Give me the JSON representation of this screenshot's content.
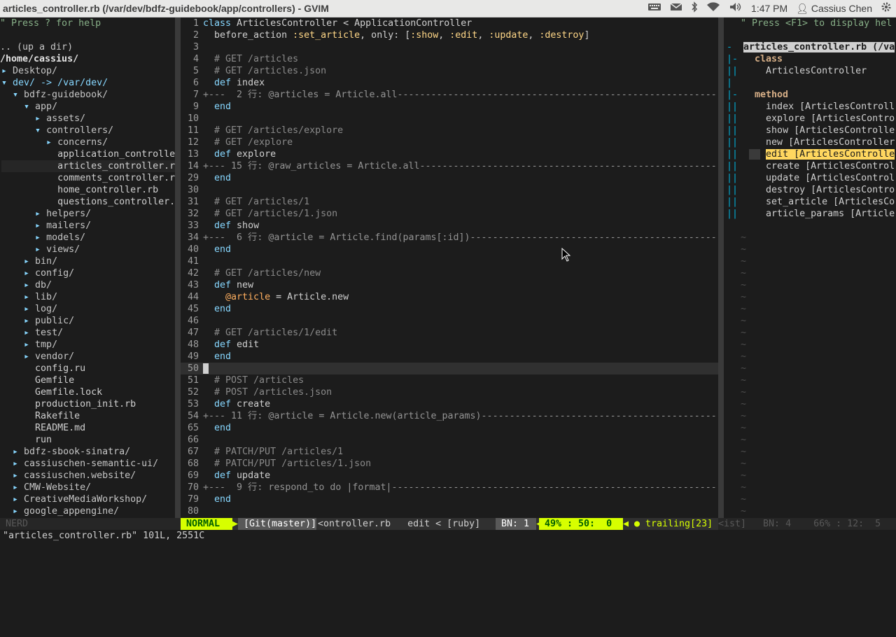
{
  "window": {
    "title": "articles_controller.rb (/var/dev/bdfz-guidebook/app/controllers) - GVIM"
  },
  "system_tray": {
    "time": "1:47 PM",
    "user": "Cassius Chen"
  },
  "nerdtree": {
    "help": "\" Press ? for help",
    "up_dir": ".. (up a dir)",
    "root": "/home/cassius/",
    "entries": [
      {
        "indent": 0,
        "marker": "▸",
        "name": "Desktop/"
      },
      {
        "indent": 0,
        "marker": "▾",
        "name": "dev/ -> /var/dev/"
      },
      {
        "indent": 1,
        "marker": "▾",
        "name": "bdfz-guidebook/"
      },
      {
        "indent": 2,
        "marker": "▾",
        "name": "app/"
      },
      {
        "indent": 3,
        "marker": "▸",
        "name": "assets/"
      },
      {
        "indent": 3,
        "marker": "▾",
        "name": "controllers/"
      },
      {
        "indent": 4,
        "marker": "▸",
        "name": "concerns/"
      },
      {
        "indent": 4,
        "marker": " ",
        "name": "application_controlle"
      },
      {
        "indent": 4,
        "marker": " ",
        "name": "articles_controller.r"
      },
      {
        "indent": 4,
        "marker": " ",
        "name": "comments_controller.r"
      },
      {
        "indent": 4,
        "marker": " ",
        "name": "home_controller.rb"
      },
      {
        "indent": 4,
        "marker": " ",
        "name": "questions_controller."
      },
      {
        "indent": 3,
        "marker": "▸",
        "name": "helpers/"
      },
      {
        "indent": 3,
        "marker": "▸",
        "name": "mailers/"
      },
      {
        "indent": 3,
        "marker": "▸",
        "name": "models/"
      },
      {
        "indent": 3,
        "marker": "▸",
        "name": "views/"
      },
      {
        "indent": 2,
        "marker": "▸",
        "name": "bin/"
      },
      {
        "indent": 2,
        "marker": "▸",
        "name": "config/"
      },
      {
        "indent": 2,
        "marker": "▸",
        "name": "db/"
      },
      {
        "indent": 2,
        "marker": "▸",
        "name": "lib/"
      },
      {
        "indent": 2,
        "marker": "▸",
        "name": "log/"
      },
      {
        "indent": 2,
        "marker": "▸",
        "name": "public/"
      },
      {
        "indent": 2,
        "marker": "▸",
        "name": "test/"
      },
      {
        "indent": 2,
        "marker": "▸",
        "name": "tmp/"
      },
      {
        "indent": 2,
        "marker": "▸",
        "name": "vendor/"
      },
      {
        "indent": 2,
        "marker": " ",
        "name": "config.ru"
      },
      {
        "indent": 2,
        "marker": " ",
        "name": "Gemfile"
      },
      {
        "indent": 2,
        "marker": " ",
        "name": "Gemfile.lock"
      },
      {
        "indent": 2,
        "marker": " ",
        "name": "production_init.rb"
      },
      {
        "indent": 2,
        "marker": " ",
        "name": "Rakefile"
      },
      {
        "indent": 2,
        "marker": " ",
        "name": "README.md"
      },
      {
        "indent": 2,
        "marker": " ",
        "name": "run"
      },
      {
        "indent": 1,
        "marker": "▸",
        "name": "bdfz-sbook-sinatra/"
      },
      {
        "indent": 1,
        "marker": "▸",
        "name": "cassiuschen-semantic-ui/"
      },
      {
        "indent": 1,
        "marker": "▸",
        "name": "cassiuschen.website/"
      },
      {
        "indent": 1,
        "marker": "▸",
        "name": "CMW-Website/"
      },
      {
        "indent": 1,
        "marker": "▸",
        "name": "CreativeMediaWorkshop/"
      },
      {
        "indent": 1,
        "marker": "▸",
        "name": "google_appengine/"
      }
    ],
    "status": "NERD"
  },
  "editor": {
    "lines": [
      {
        "n": "1",
        "text": "class ArticlesController < ApplicationController",
        "kind": "code"
      },
      {
        "n": "2",
        "text": "  before_action :set_article, only: [:show, :edit, :update, :destroy]",
        "kind": "code"
      },
      {
        "n": "3",
        "text": "",
        "kind": "code"
      },
      {
        "n": "4",
        "text": "  # GET /articles",
        "kind": "comment"
      },
      {
        "n": "5",
        "text": "  # GET /articles.json",
        "kind": "comment"
      },
      {
        "n": "6",
        "text": "  def index",
        "kind": "code"
      },
      {
        "n": "7",
        "text": "+---  2 行: @articles = Article.all--------------------------------------------------------------",
        "kind": "fold"
      },
      {
        "n": "9",
        "text": "  end",
        "kind": "code"
      },
      {
        "n": "10",
        "text": "",
        "kind": "code"
      },
      {
        "n": "11",
        "text": "  # GET /articles/explore",
        "kind": "comment"
      },
      {
        "n": "12",
        "text": "  # GET /explore",
        "kind": "comment"
      },
      {
        "n": "13",
        "text": "  def explore",
        "kind": "code"
      },
      {
        "n": "14",
        "text": "+--- 15 行: @raw_articles = Article.all----------------------------------------------------------",
        "kind": "fold"
      },
      {
        "n": "29",
        "text": "  end",
        "kind": "code"
      },
      {
        "n": "30",
        "text": "",
        "kind": "code"
      },
      {
        "n": "31",
        "text": "  # GET /articles/1",
        "kind": "comment"
      },
      {
        "n": "32",
        "text": "  # GET /articles/1.json",
        "kind": "comment"
      },
      {
        "n": "33",
        "text": "  def show",
        "kind": "code"
      },
      {
        "n": "34",
        "text": "+---  6 行: @article = Article.find(params[:id])-------------------------------------------------",
        "kind": "fold"
      },
      {
        "n": "40",
        "text": "  end",
        "kind": "code"
      },
      {
        "n": "41",
        "text": "",
        "kind": "code"
      },
      {
        "n": "42",
        "text": "  # GET /articles/new",
        "kind": "comment"
      },
      {
        "n": "43",
        "text": "  def new",
        "kind": "code"
      },
      {
        "n": "44",
        "text": "    @article = Article.new",
        "kind": "code"
      },
      {
        "n": "45",
        "text": "  end",
        "kind": "code"
      },
      {
        "n": "46",
        "text": "",
        "kind": "code"
      },
      {
        "n": "47",
        "text": "  # GET /articles/1/edit",
        "kind": "comment"
      },
      {
        "n": "48",
        "text": "  def edit",
        "kind": "code"
      },
      {
        "n": "49",
        "text": "  end",
        "kind": "code"
      },
      {
        "n": "50",
        "text": "",
        "kind": "cursor"
      },
      {
        "n": "51",
        "text": "  # POST /articles",
        "kind": "comment"
      },
      {
        "n": "52",
        "text": "  # POST /articles.json",
        "kind": "comment"
      },
      {
        "n": "53",
        "text": "  def create",
        "kind": "code"
      },
      {
        "n": "54",
        "text": "+--- 11 行: @article = Article.new(article_params)-----------------------------------------------",
        "kind": "fold"
      },
      {
        "n": "65",
        "text": "  end",
        "kind": "code"
      },
      {
        "n": "66",
        "text": "",
        "kind": "code"
      },
      {
        "n": "67",
        "text": "  # PATCH/PUT /articles/1",
        "kind": "comment"
      },
      {
        "n": "68",
        "text": "  # PATCH/PUT /articles/1.json",
        "kind": "comment"
      },
      {
        "n": "69",
        "text": "  def update",
        "kind": "code"
      },
      {
        "n": "70",
        "text": "+---  9 行: respond_to do |format|---------------------------------------------------------------",
        "kind": "fold"
      },
      {
        "n": "79",
        "text": "  end",
        "kind": "code"
      },
      {
        "n": "80",
        "text": "",
        "kind": "code"
      }
    ]
  },
  "tagbar": {
    "help": "\" Press <F1> to display hel",
    "file": "articles_controller.rb (/va",
    "class_label": "class",
    "class_name": "ArticlesController",
    "method_label": "method",
    "methods": [
      "index [ArticlesControll",
      "explore [ArticlesContro",
      "show [ArticlesControlle",
      "new [ArticlesController",
      "edit [ArticlesControlle",
      "create [ArticlesControl",
      "update [ArticlesControl",
      "destroy [ArticlesContro",
      "set_article [ArticlesCo",
      "article_params [Article"
    ],
    "selected_method": 4,
    "status": "<ist]   BN: 4    66% : 12:  5"
  },
  "airline": {
    "mode": " NORMAL ",
    "branch": " [Git(master)] ",
    "file": "<ontroller.rb   edit < [ruby] ",
    "buffer": " BN: 1 ",
    "position": " 49% : 50:  0 ",
    "warning": " ● trailing[23]"
  },
  "cmdline": "\"articles_controller.rb\" 101L, 2551C",
  "colors": {
    "mode_bg": "#d7ff00",
    "selected_tag_bg": "#ffd75f",
    "keyword": "#87d7ff",
    "comment": "#8a8a8a"
  }
}
